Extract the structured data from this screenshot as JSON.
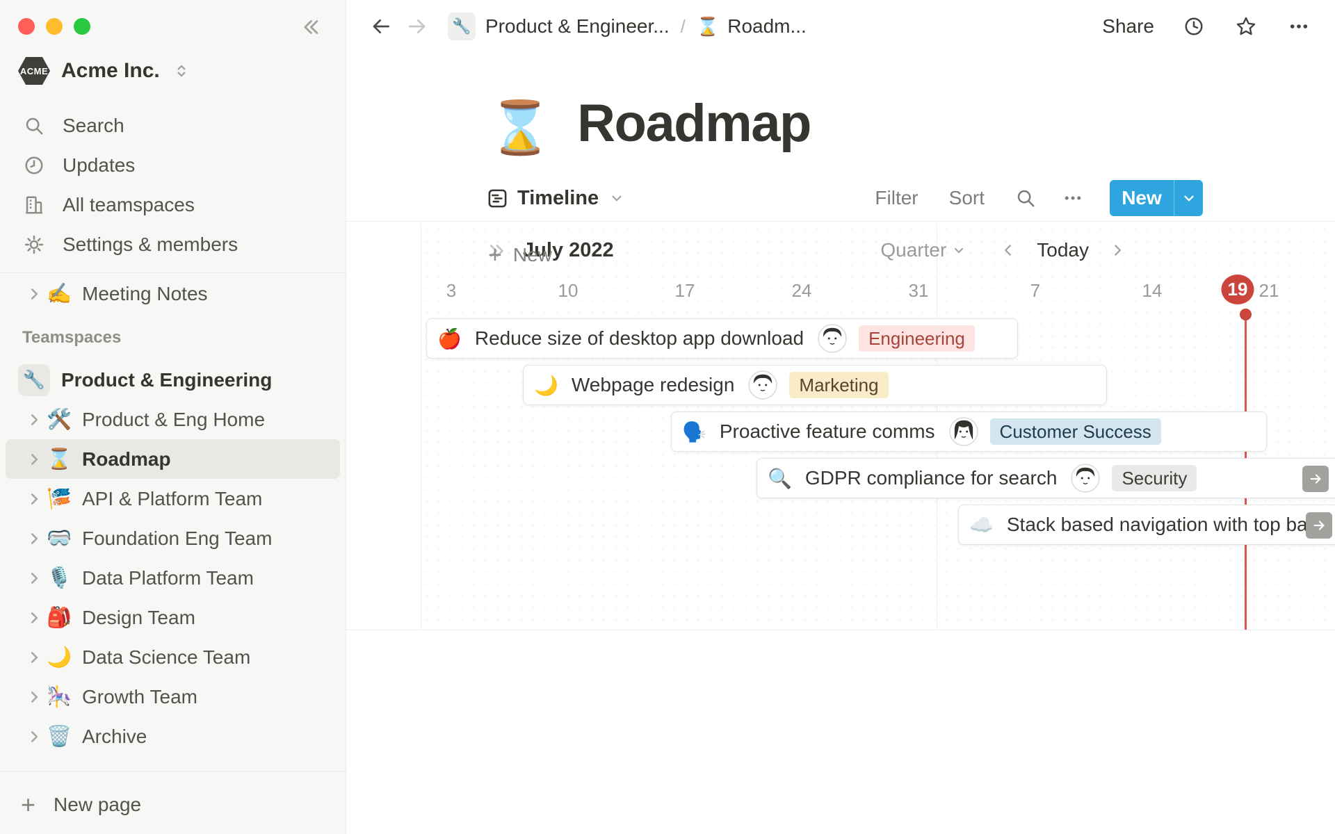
{
  "colors": {
    "accent": "#2FA5DF",
    "today_red": "#CB453C",
    "today_line": "#DE5450"
  },
  "sidebar": {
    "workspace": {
      "logo_text": "ACME",
      "name": "Acme Inc."
    },
    "items": [
      {
        "label": "Search"
      },
      {
        "label": "Updates"
      },
      {
        "label": "All teamspaces"
      },
      {
        "label": "Settings & members"
      }
    ],
    "meeting_notes": {
      "emoji": "✍️",
      "label": "Meeting Notes"
    },
    "teamspaces_label": "Teamspaces",
    "teamspaces": [
      {
        "emoji": "🔧",
        "label": "Product & Engineering",
        "variant": "space"
      },
      {
        "emoji": "🛠️",
        "label": "Product & Eng Home"
      },
      {
        "emoji": "⌛",
        "label": "Roadmap",
        "variant": "selected"
      },
      {
        "emoji": "🎏",
        "label": "API & Platform Team"
      },
      {
        "emoji": "🥽",
        "label": "Foundation Eng Team"
      },
      {
        "emoji": "🎙️",
        "label": "Data Platform Team"
      },
      {
        "emoji": "🎒",
        "label": "Design Team"
      },
      {
        "emoji": "🌙",
        "label": "Data Science Team"
      },
      {
        "emoji": "🎠",
        "label": "Growth Team"
      },
      {
        "emoji": "🗑️",
        "label": "Archive"
      }
    ],
    "new_page_label": "New page"
  },
  "topbar": {
    "breadcrumb_parent_emoji": "🔧",
    "breadcrumb_parent": "Product & Engineer...",
    "separator": "/",
    "breadcrumb_page_emoji": "⌛",
    "breadcrumb_page": "Roadm...",
    "share_label": "Share"
  },
  "page": {
    "emoji": "⌛",
    "title": "Roadmap"
  },
  "toolbar": {
    "view_label": "Timeline",
    "filter_label": "Filter",
    "sort_label": "Sort",
    "new_label": "New"
  },
  "timeline": {
    "month_label": "July 2022",
    "zoom_label": "Quarter",
    "today_label": "Today",
    "dates": [
      {
        "d": "3",
        "variant": "d1"
      },
      {
        "d": "10",
        "variant": "d2"
      },
      {
        "d": "17",
        "variant": "d3"
      },
      {
        "d": "24",
        "variant": "d4"
      },
      {
        "d": "31",
        "variant": "d5"
      },
      {
        "d": "7",
        "variant": "d6"
      },
      {
        "d": "14",
        "variant": "d7"
      },
      {
        "d": "19",
        "variant": "d8 today",
        "today": true
      },
      {
        "d": "21",
        "variant": "d9"
      }
    ],
    "cards": [
      {
        "emoji": "🍎",
        "title": "Reduce size of desktop app download",
        "avatar": true,
        "tag": "Engineering",
        "variant": "c1 tag-red"
      },
      {
        "emoji": "🌙",
        "title": "Webpage redesign",
        "avatar": true,
        "tag": "Marketing",
        "variant": "c2 tag-yellow"
      },
      {
        "emoji": "🗣️",
        "title": "Proactive feature comms",
        "avatar": true,
        "tag": "Customer Success",
        "variant": "c3 tag-blue av-woman"
      },
      {
        "emoji": "🔍",
        "title": "GDPR compliance for search",
        "avatar": true,
        "tag": "Security",
        "variant": "c4 tag-gray",
        "arrow": true
      },
      {
        "emoji": "☁️",
        "title": "Stack based navigation with top bar",
        "variant": "c5",
        "arrow": true
      }
    ],
    "new_row_label": "New"
  }
}
